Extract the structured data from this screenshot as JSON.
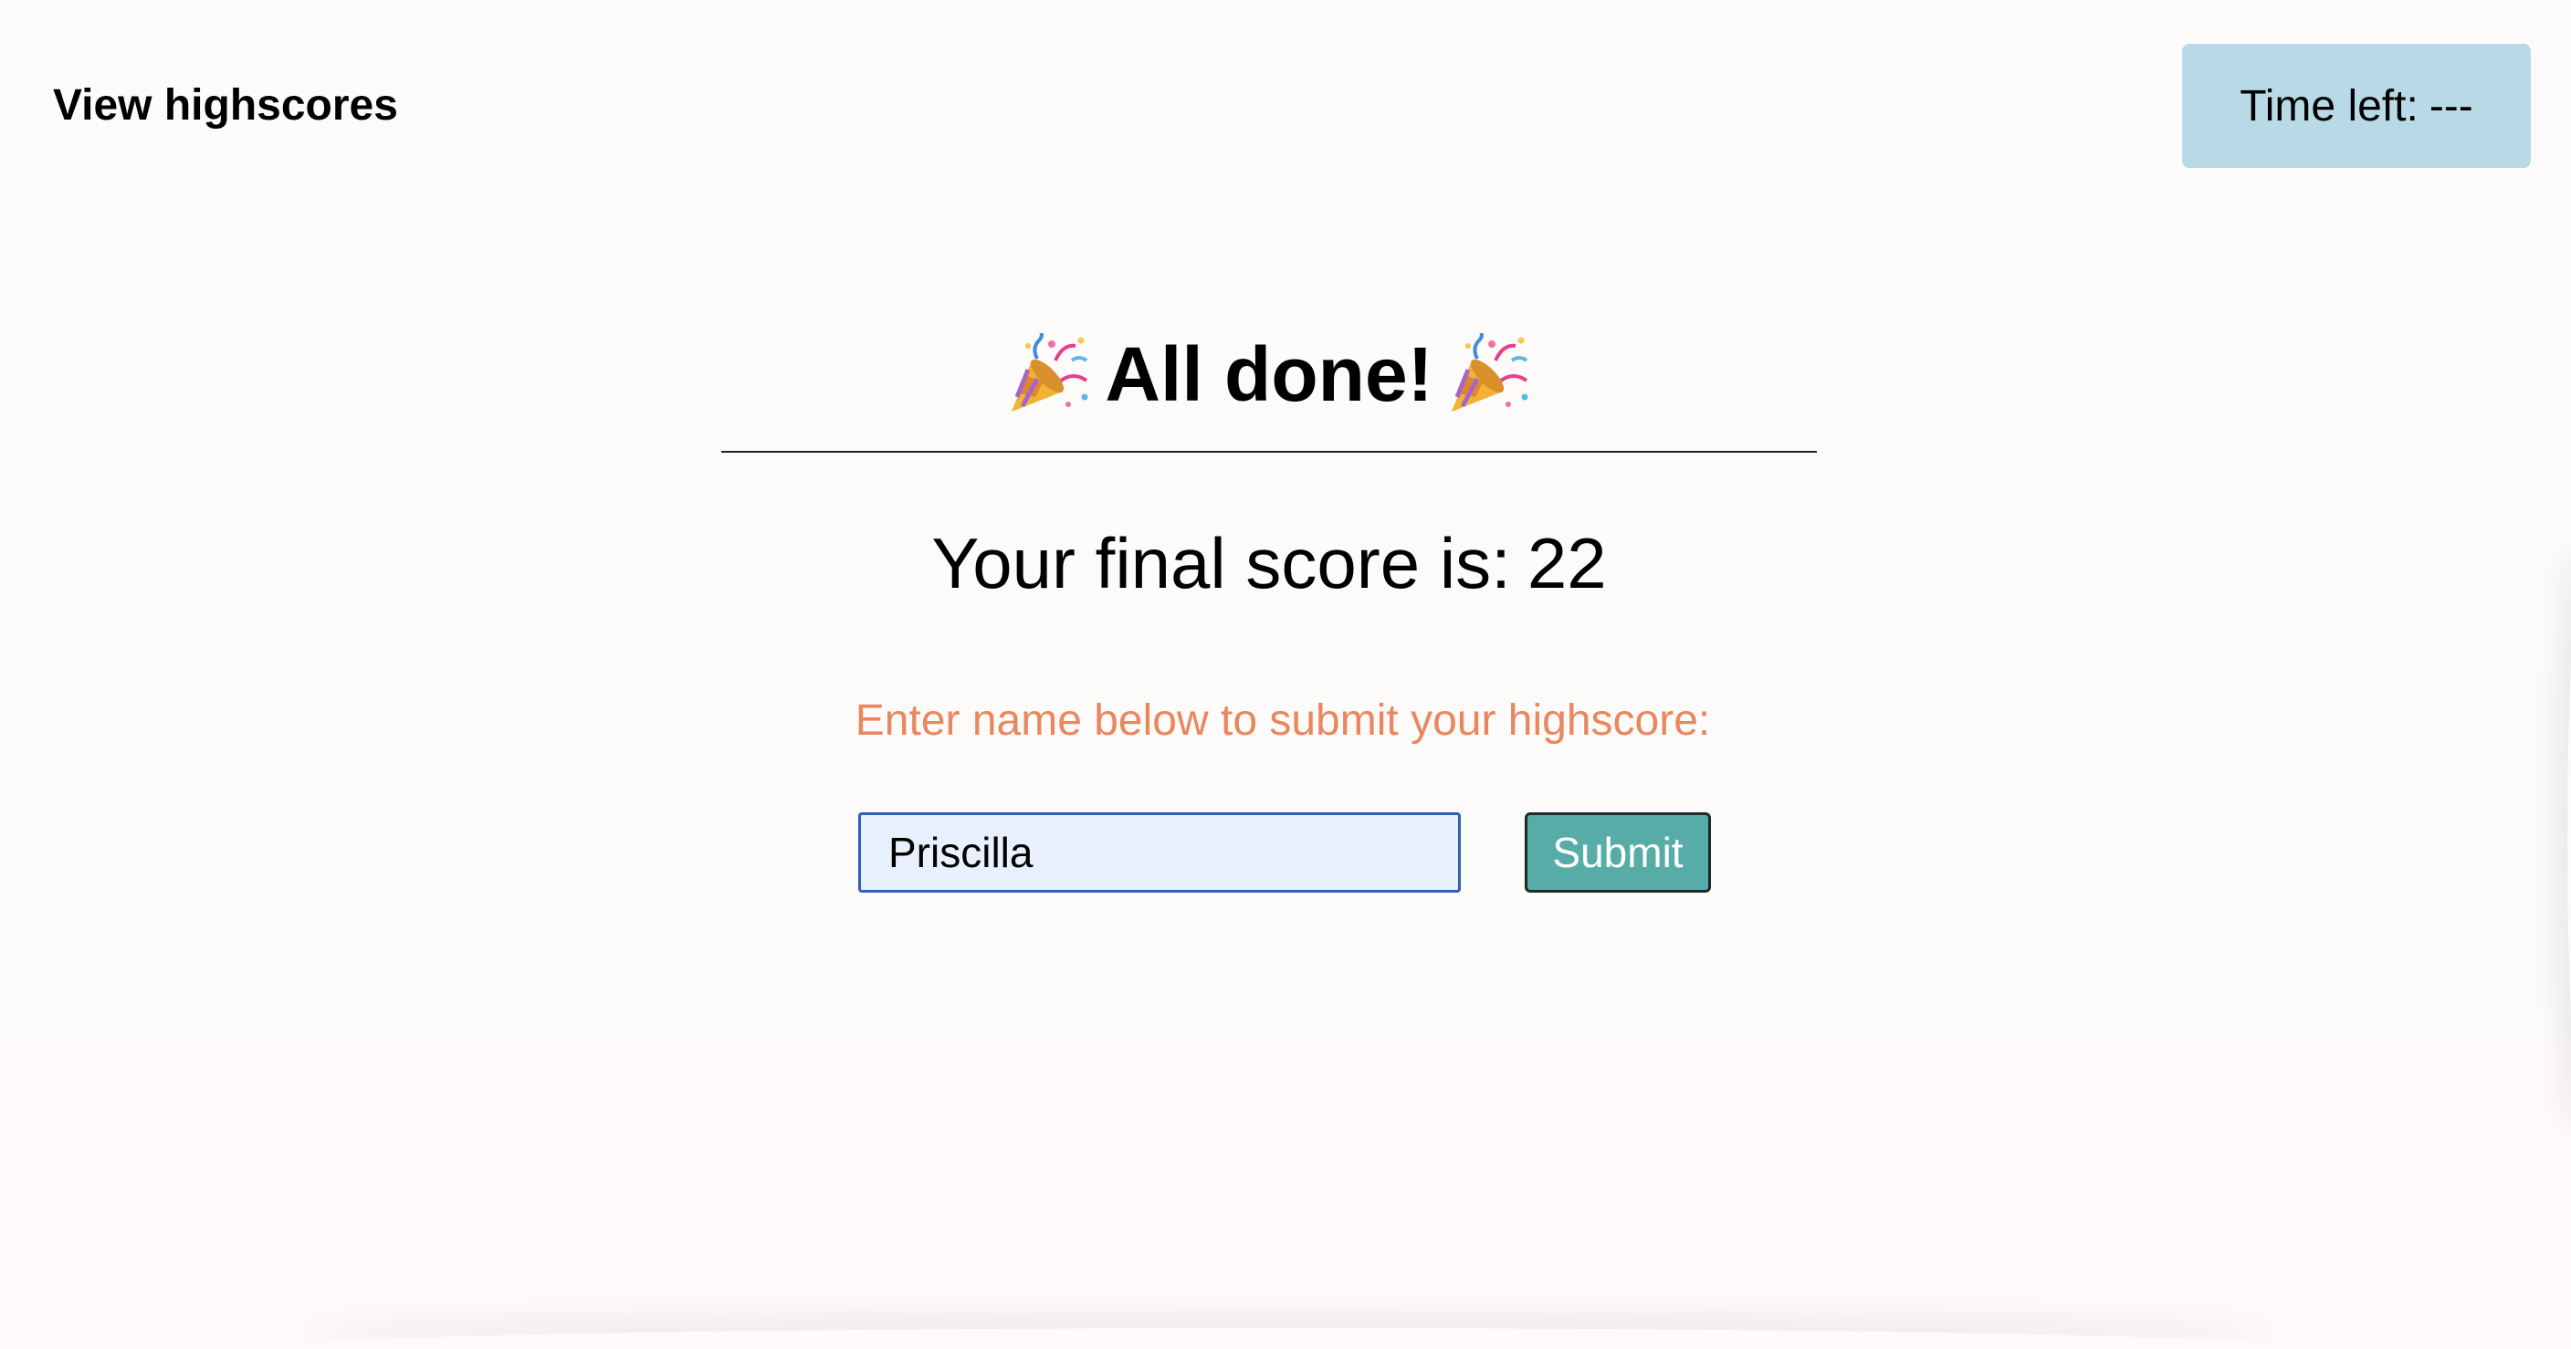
{
  "header": {
    "highscores_link": "View highscores",
    "timer": {
      "label": "Time left:",
      "value": "---"
    }
  },
  "main": {
    "title": "All done!",
    "score": {
      "label": "Your final score is:",
      "value": "22"
    },
    "prompt": "Enter name below to submit your highscore:",
    "name_input": {
      "value": "Priscilla"
    },
    "submit_label": "Submit"
  },
  "icons": {
    "title_decoration": "party-popper-icon"
  },
  "colors": {
    "background": "#fcfbf9",
    "timer_background": "#b7dae6",
    "prompt_text": "#e9875f",
    "input_background": "#e8f0fe",
    "input_border": "#2e63b4",
    "submit_background": "#57aca7"
  }
}
